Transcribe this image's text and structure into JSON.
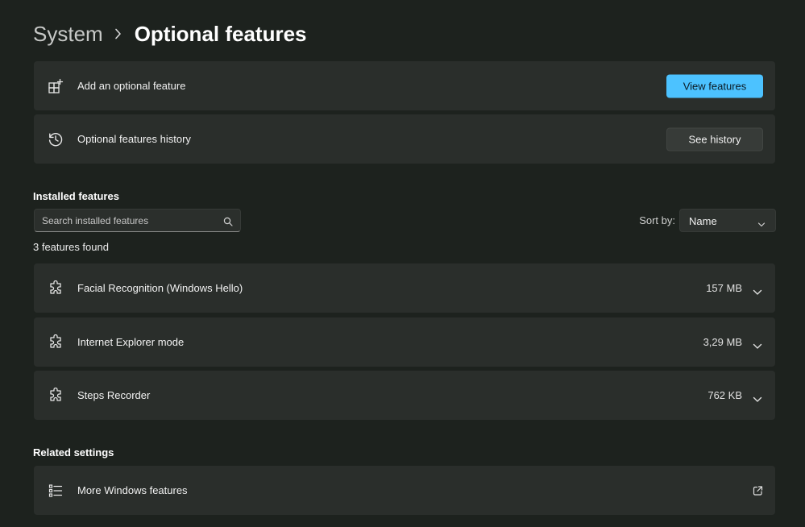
{
  "breadcrumb": {
    "parent": "System",
    "current": "Optional features"
  },
  "add_feature": {
    "label": "Add an optional feature",
    "button": "View features",
    "icon": "add-apps-icon"
  },
  "history": {
    "label": "Optional features history",
    "button": "See history",
    "icon": "history-icon"
  },
  "installed": {
    "title": "Installed features",
    "search_placeholder": "Search installed features",
    "sort_label": "Sort by:",
    "sort_value": "Name",
    "count_text": "3 features found",
    "features": [
      {
        "name": "Facial Recognition (Windows Hello)",
        "size": "157 MB"
      },
      {
        "name": "Internet Explorer mode",
        "size": "3,29 MB"
      },
      {
        "name": "Steps Recorder",
        "size": "762 KB"
      }
    ]
  },
  "related": {
    "title": "Related settings",
    "items": [
      {
        "label": "More Windows features",
        "icon": "list-icon"
      }
    ]
  },
  "colors": {
    "accent": "#4cc2ff",
    "background": "#1d221e",
    "card": "#2a2e2b"
  }
}
